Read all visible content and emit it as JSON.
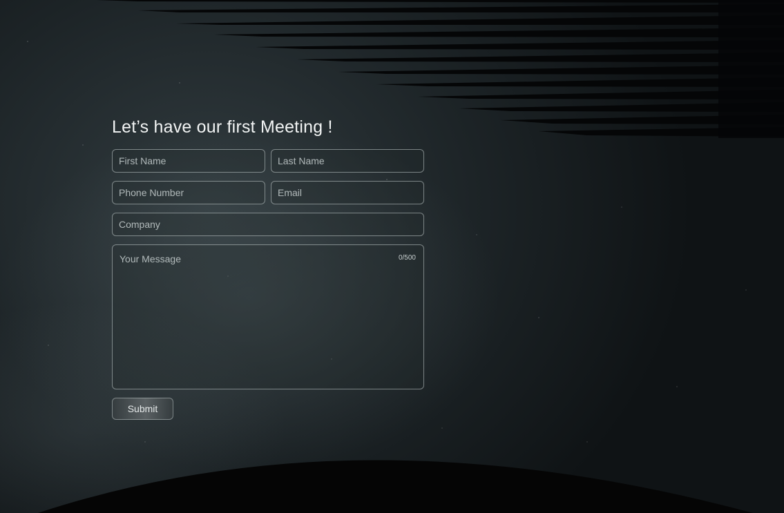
{
  "form": {
    "title": "Let’s have our first Meeting !",
    "first_name_placeholder": "First Name",
    "last_name_placeholder": "Last Name",
    "phone_placeholder": "Phone Number",
    "email_placeholder": "Email",
    "company_placeholder": "Company",
    "message_placeholder": "Your Message",
    "char_counter": "0/500",
    "submit_label": "Submit"
  },
  "colors": {
    "background": "#1d2427",
    "text": "#f2f4f4",
    "field_border": "#c8d2d2"
  }
}
